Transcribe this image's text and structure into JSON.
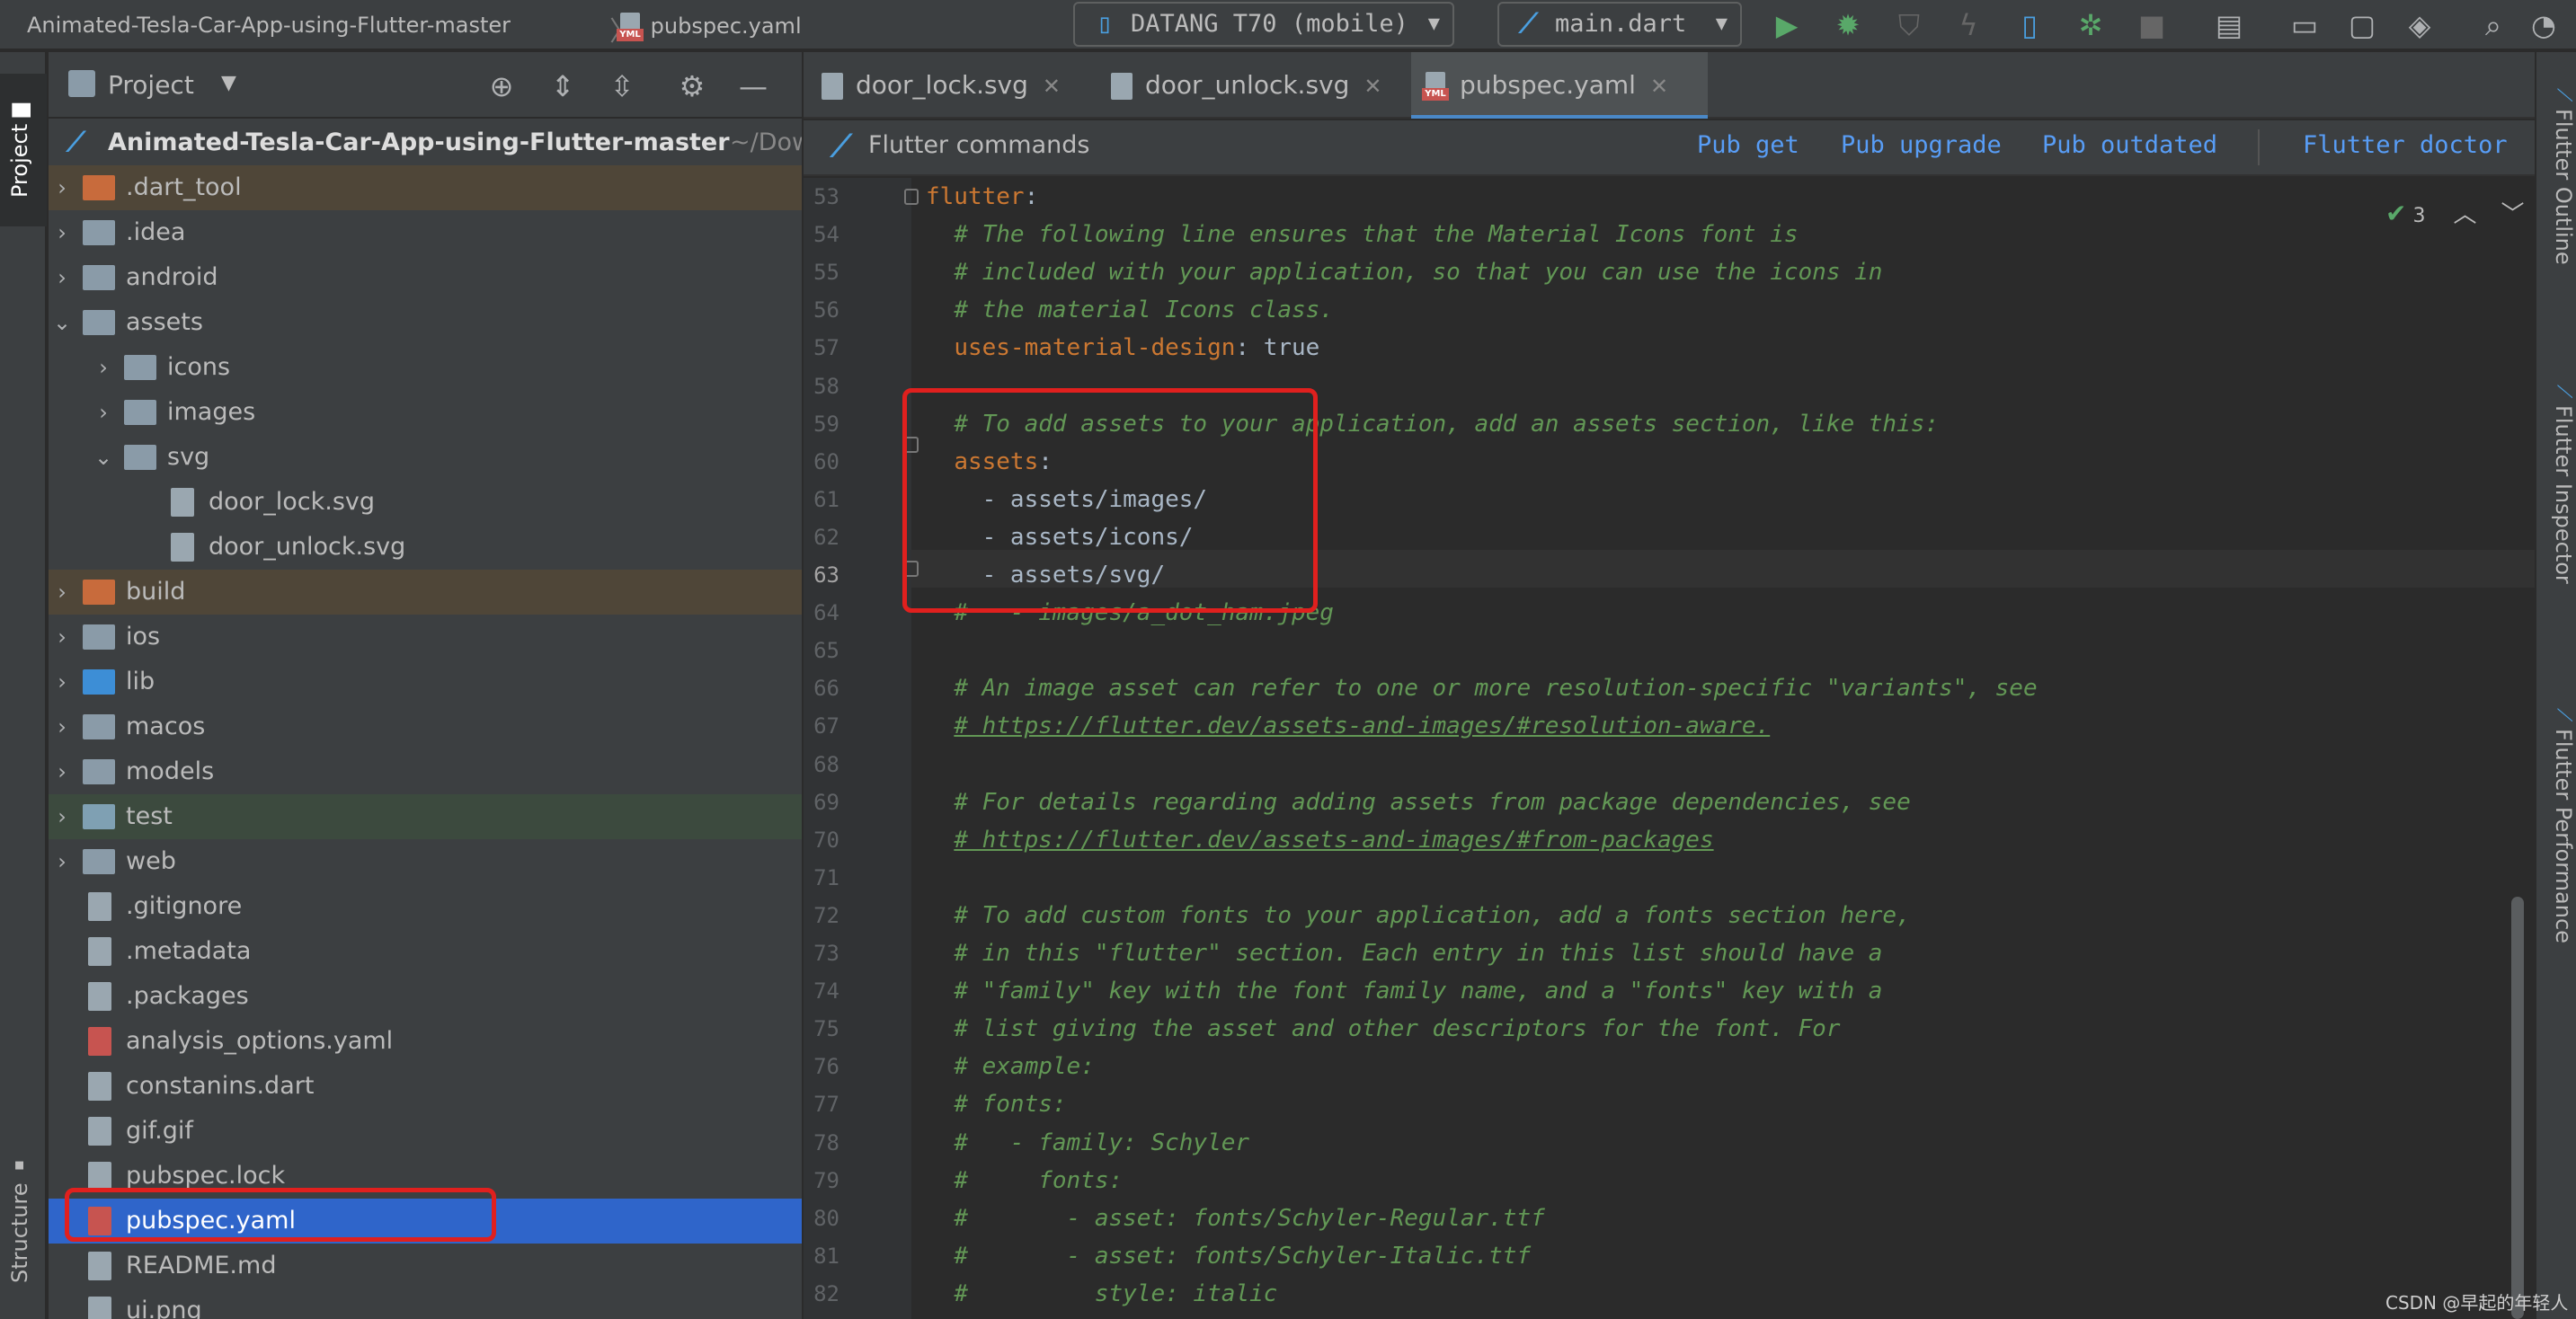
{
  "topbar": {
    "project_breadcrumb": "Animated-Tesla-Car-App-using-Flutter-master",
    "file_breadcrumb": "pubspec.yaml",
    "device_selector": "DATANG T70 (mobile)",
    "run_config": "main.dart"
  },
  "left_strip": {
    "project_tab": "Project",
    "structure_tab": "Structure"
  },
  "right_strip": {
    "tabs": [
      "Flutter Outline",
      "Flutter Inspector",
      "Flutter Performance"
    ]
  },
  "project_panel": {
    "title": "Project",
    "root": {
      "name": "Animated-Tesla-Car-App-using-Flutter-master",
      "path": "~/Dow"
    },
    "items": [
      {
        "label": ".dart_tool",
        "depth": 0,
        "expanded": false,
        "type": "folder-excluded"
      },
      {
        "label": ".idea",
        "depth": 0,
        "expanded": false,
        "type": "folder"
      },
      {
        "label": "android",
        "depth": 0,
        "expanded": false,
        "type": "folder"
      },
      {
        "label": "assets",
        "depth": 0,
        "expanded": true,
        "type": "folder"
      },
      {
        "label": "icons",
        "depth": 1,
        "expanded": false,
        "type": "folder"
      },
      {
        "label": "images",
        "depth": 1,
        "expanded": false,
        "type": "folder"
      },
      {
        "label": "svg",
        "depth": 1,
        "expanded": true,
        "type": "folder"
      },
      {
        "label": "door_lock.svg",
        "depth": 2,
        "type": "file"
      },
      {
        "label": "door_unlock.svg",
        "depth": 2,
        "type": "file"
      },
      {
        "label": "build",
        "depth": 0,
        "expanded": false,
        "type": "folder-excluded"
      },
      {
        "label": "ios",
        "depth": 0,
        "expanded": false,
        "type": "folder"
      },
      {
        "label": "lib",
        "depth": 0,
        "expanded": false,
        "type": "folder-source"
      },
      {
        "label": "macos",
        "depth": 0,
        "expanded": false,
        "type": "folder"
      },
      {
        "label": "models",
        "depth": 0,
        "expanded": false,
        "type": "folder"
      },
      {
        "label": "test",
        "depth": 0,
        "expanded": false,
        "type": "folder-test"
      },
      {
        "label": "web",
        "depth": 0,
        "expanded": false,
        "type": "folder"
      },
      {
        "label": ".gitignore",
        "depth": 0,
        "type": "file"
      },
      {
        "label": ".metadata",
        "depth": 0,
        "type": "file"
      },
      {
        "label": ".packages",
        "depth": 0,
        "type": "file"
      },
      {
        "label": "analysis_options.yaml",
        "depth": 0,
        "type": "yaml"
      },
      {
        "label": "constanins.dart",
        "depth": 0,
        "type": "file"
      },
      {
        "label": "gif.gif",
        "depth": 0,
        "type": "file"
      },
      {
        "label": "pubspec.lock",
        "depth": 0,
        "type": "file"
      },
      {
        "label": "pubspec.yaml",
        "depth": 0,
        "type": "yaml",
        "selected": true
      },
      {
        "label": "README.md",
        "depth": 0,
        "type": "file"
      },
      {
        "label": "ui.png",
        "depth": 0,
        "type": "file"
      }
    ]
  },
  "editor_tabs": [
    {
      "label": "door_lock.svg",
      "active": false
    },
    {
      "label": "door_unlock.svg",
      "active": false
    },
    {
      "label": "pubspec.yaml",
      "active": true
    }
  ],
  "flutter_commands": {
    "title": "Flutter commands",
    "pub_get": "Pub get",
    "pub_upgrade": "Pub upgrade",
    "pub_outdated": "Pub outdated",
    "flutter_doctor": "Flutter doctor"
  },
  "inspection": {
    "count": "3"
  },
  "editor": {
    "current_line": 63,
    "lines": [
      {
        "n": "53",
        "indent": "",
        "key": "flutter",
        "value": ":",
        "comment": ""
      },
      {
        "n": "54",
        "indent": "  ",
        "key": "",
        "value": "",
        "comment": "# The following line ensures that the Material Icons font is"
      },
      {
        "n": "55",
        "indent": "  ",
        "key": "",
        "value": "",
        "comment": "# included with your application, so that you can use the icons in"
      },
      {
        "n": "56",
        "indent": "  ",
        "key": "",
        "value": "",
        "comment": "# the material Icons class."
      },
      {
        "n": "57",
        "indent": "  ",
        "key": "uses-material-design",
        "value": ": true",
        "comment": ""
      },
      {
        "n": "58",
        "indent": "",
        "key": "",
        "value": "",
        "comment": ""
      },
      {
        "n": "59",
        "indent": "  ",
        "key": "",
        "value": "",
        "comment": "# To add assets to your application, add an assets section, like this:"
      },
      {
        "n": "60",
        "indent": "  ",
        "key": "assets",
        "value": ":",
        "comment": ""
      },
      {
        "n": "61",
        "indent": "    ",
        "key": "",
        "value": "- assets/images/",
        "comment": ""
      },
      {
        "n": "62",
        "indent": "    ",
        "key": "",
        "value": "- assets/icons/",
        "comment": ""
      },
      {
        "n": "63",
        "indent": "    ",
        "key": "",
        "value": "- assets/svg/",
        "comment": ""
      },
      {
        "n": "64",
        "indent": "  ",
        "key": "",
        "value": "",
        "comment": "#   - images/a_dot_ham.jpeg"
      },
      {
        "n": "65",
        "indent": "",
        "key": "",
        "value": "",
        "comment": ""
      },
      {
        "n": "66",
        "indent": "  ",
        "key": "",
        "value": "",
        "comment": "# An image asset can refer to one or more resolution-specific \"variants\", see"
      },
      {
        "n": "67",
        "indent": "  ",
        "key": "",
        "value": "",
        "comment": "# https://flutter.dev/assets-and-images/#resolution-aware."
      },
      {
        "n": "68",
        "indent": "",
        "key": "",
        "value": "",
        "comment": ""
      },
      {
        "n": "69",
        "indent": "  ",
        "key": "",
        "value": "",
        "comment": "# For details regarding adding assets from package dependencies, see"
      },
      {
        "n": "70",
        "indent": "  ",
        "key": "",
        "value": "",
        "comment": "# https://flutter.dev/assets-and-images/#from-packages"
      },
      {
        "n": "71",
        "indent": "",
        "key": "",
        "value": "",
        "comment": ""
      },
      {
        "n": "72",
        "indent": "  ",
        "key": "",
        "value": "",
        "comment": "# To add custom fonts to your application, add a fonts section here,"
      },
      {
        "n": "73",
        "indent": "  ",
        "key": "",
        "value": "",
        "comment": "# in this \"flutter\" section. Each entry in this list should have a"
      },
      {
        "n": "74",
        "indent": "  ",
        "key": "",
        "value": "",
        "comment": "# \"family\" key with the font family name, and a \"fonts\" key with a"
      },
      {
        "n": "75",
        "indent": "  ",
        "key": "",
        "value": "",
        "comment": "# list giving the asset and other descriptors for the font. For"
      },
      {
        "n": "76",
        "indent": "  ",
        "key": "",
        "value": "",
        "comment": "# example:"
      },
      {
        "n": "77",
        "indent": "  ",
        "key": "",
        "value": "",
        "comment": "# fonts:"
      },
      {
        "n": "78",
        "indent": "  ",
        "key": "",
        "value": "",
        "comment": "#   - family: Schyler"
      },
      {
        "n": "79",
        "indent": "  ",
        "key": "",
        "value": "",
        "comment": "#     fonts:"
      },
      {
        "n": "80",
        "indent": "  ",
        "key": "",
        "value": "",
        "comment": "#       - asset: fonts/Schyler-Regular.ttf"
      },
      {
        "n": "81",
        "indent": "  ",
        "key": "",
        "value": "",
        "comment": "#       - asset: fonts/Schyler-Italic.ttf"
      },
      {
        "n": "82",
        "indent": "  ",
        "key": "",
        "value": "",
        "comment": "#         style: italic"
      }
    ]
  },
  "watermark": "CSDN @早起的年轻人",
  "colors": {
    "selection": "#2f65ca",
    "annotation_box": "#e0201e",
    "keyword": "#cc7832",
    "comment": "#629755",
    "link": "#589df6"
  }
}
